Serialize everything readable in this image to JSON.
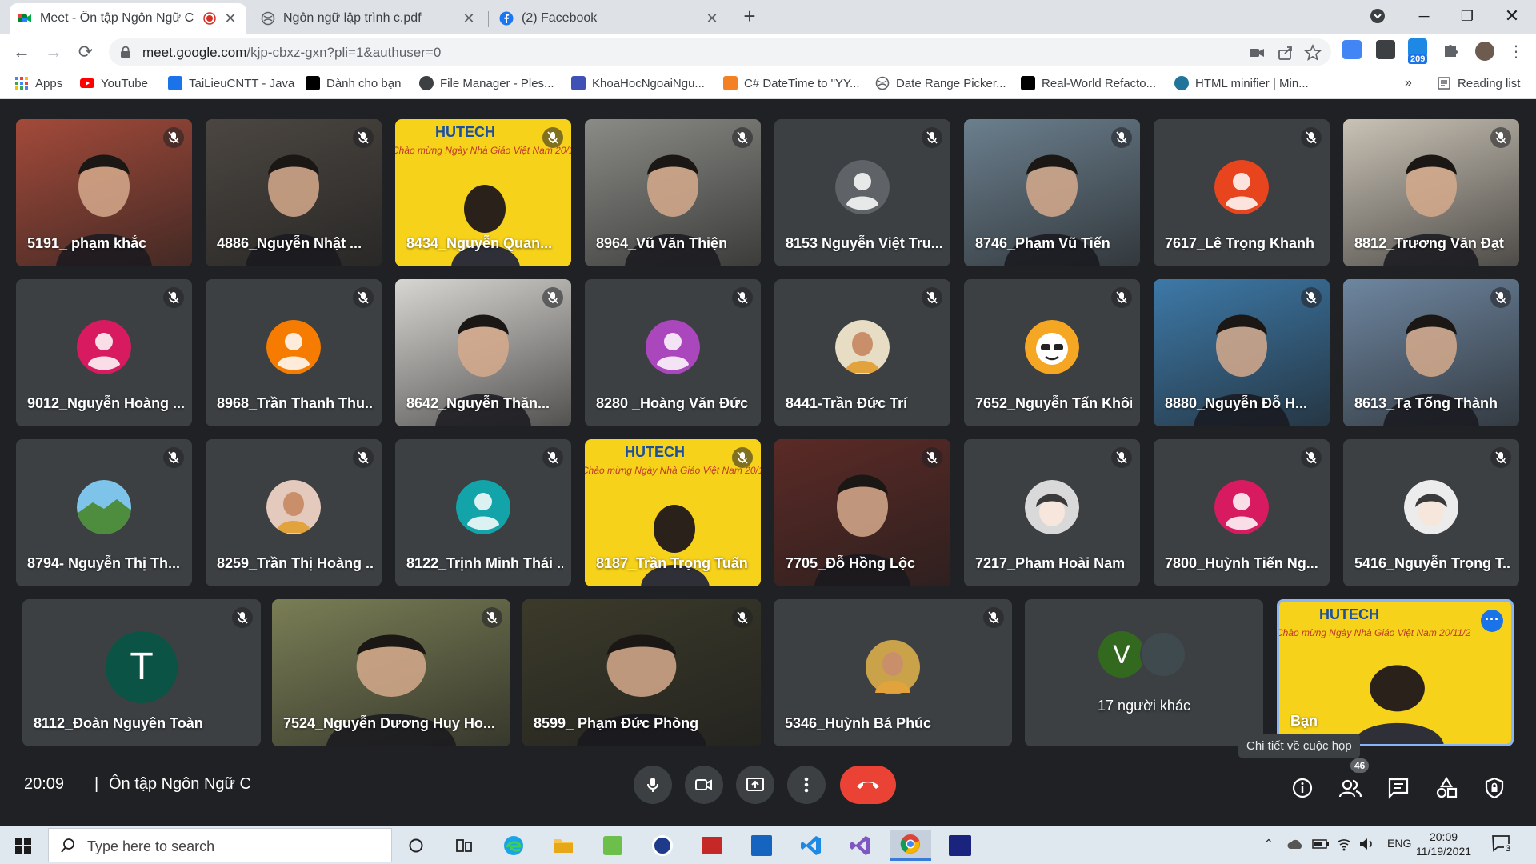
{
  "browser": {
    "tabs": [
      {
        "title": "Meet - Ôn tập Ngôn Ngữ C",
        "icon": "meet-icon",
        "recording": true
      },
      {
        "title": "Ngôn ngữ lập trình c.pdf",
        "icon": "globe-icon"
      },
      {
        "title": "(2) Facebook",
        "icon": "facebook-icon"
      }
    ],
    "url_host": "meet.google.com",
    "url_rest": "/kjp-cbxz-gxn?pli=1&authuser=0",
    "extension_badge": "209"
  },
  "bookmarks": [
    {
      "label": "Apps",
      "icon": "apps-icon",
      "color": "#4285f4"
    },
    {
      "label": "YouTube",
      "icon": "youtube-icon",
      "color": "#ff0000"
    },
    {
      "label": "TaiLieuCNTT - Java",
      "icon": "tailieu-icon",
      "color": "#1a73e8"
    },
    {
      "label": "Dành cho bạn",
      "icon": "tiktok-icon",
      "color": "#000000"
    },
    {
      "label": "File Manager - Ples...",
      "icon": "plesk-icon",
      "color": "#3c4043"
    },
    {
      "label": "KhoaHocNgoaiNgu...",
      "icon": "khoahoc-icon",
      "color": "#3f51b5"
    },
    {
      "label": "C# DateTime to \"YY...",
      "icon": "csharp-icon",
      "color": "#f48024"
    },
    {
      "label": "Date Range Picker...",
      "icon": "globe-icon",
      "color": "#5f6368"
    },
    {
      "label": "Real-World Refacto...",
      "icon": "dw-icon",
      "color": "#000000"
    },
    {
      "label": "HTML minifier | Min...",
      "icon": "wordpress-icon",
      "color": "#21759b"
    }
  ],
  "bookmarks_overflow": "»",
  "reading_list": "Reading list",
  "participants": [
    {
      "name": "5191_ phạm khắc",
      "type": "video",
      "bg": "#a34a3a"
    },
    {
      "name": "4886_Nguyễn Nhật ...",
      "type": "video",
      "bg": "#4b4641"
    },
    {
      "name": "8434_Nguyễn Quan...",
      "type": "hutech",
      "bg": "#f7d21a"
    },
    {
      "name": "8964_Vũ Văn Thiện",
      "type": "video",
      "bg": "#8a8b86"
    },
    {
      "name": "8153 Nguyễn Việt Tru...",
      "type": "avatar",
      "avatar": "default",
      "color": "#5f6368"
    },
    {
      "name": "8746_Phạm Vũ Tiến",
      "type": "video",
      "bg": "#6b7f8e"
    },
    {
      "name": "7617_Lê Trọng Khanh",
      "type": "avatar",
      "avatar": "initial-person",
      "color": "#e8451f"
    },
    {
      "name": "8812_Trương Văn Đạt",
      "type": "video",
      "bg": "#c9c2b5"
    },
    {
      "name": "9012_Nguyễn Hoàng ...",
      "type": "avatar",
      "avatar": "initial-person",
      "color": "#d81b60"
    },
    {
      "name": "8968_Trần Thanh Thu...",
      "type": "avatar",
      "avatar": "initial-person",
      "color": "#f57c00"
    },
    {
      "name": "8642_Nguyễn Thăn...",
      "type": "video",
      "bg": "#d8d6d2"
    },
    {
      "name": "8280 _Hoàng Văn Đức",
      "type": "avatar",
      "avatar": "initial-person",
      "color": "#ab47bc"
    },
    {
      "name": "8441-Trần Đức Trí",
      "type": "avatar",
      "avatar": "photo",
      "color": "#e7dcc4"
    },
    {
      "name": "7652_Nguyễn Tấn Khôi",
      "type": "avatar",
      "avatar": "cartoon",
      "color": "#f5a623"
    },
    {
      "name": "8880_Nguyễn Đỗ H...",
      "type": "video",
      "bg": "#3d79a8"
    },
    {
      "name": "8613_Tạ Tống Thành",
      "type": "video",
      "bg": "#6e86a0"
    },
    {
      "name": "8794- Nguyễn Thị Th...",
      "type": "avatar",
      "avatar": "landscape",
      "color": "#4f8d3e"
    },
    {
      "name": "8259_Trần Thị Hoàng ...",
      "type": "avatar",
      "avatar": "photo",
      "color": "#e4c9bd"
    },
    {
      "name": "8122_Trịnh Minh Thái ...",
      "type": "avatar",
      "avatar": "initial-person",
      "color": "#12a4a8"
    },
    {
      "name": "8187_Trần Trọng Tuấn",
      "type": "hutech",
      "bg": "#f7d21a"
    },
    {
      "name": "7705_Đỗ Hồng Lộc",
      "type": "video",
      "bg": "#5b2a26"
    },
    {
      "name": "7217_Phạm Hoài Nam",
      "type": "avatar",
      "avatar": "anime",
      "color": "#d9d9d9"
    },
    {
      "name": "7800_Huỳnh Tiến Ng...",
      "type": "avatar",
      "avatar": "initial-person",
      "color": "#d81b60"
    },
    {
      "name": "5416_Nguyễn Trọng T...",
      "type": "avatar",
      "avatar": "anime",
      "color": "#ececec"
    }
  ],
  "bottom_row": [
    {
      "name": "8112_Đoàn Nguyên Toàn",
      "type": "letter",
      "letter": "T",
      "color": "#0b5345"
    },
    {
      "name": "7524_Nguyễn Dương Huy Ho...",
      "type": "video",
      "bg": "#7a7e55"
    },
    {
      "name": "8599_ Phạm Đức Phòng",
      "type": "video",
      "bg": "#3b3a2a"
    },
    {
      "name": "5346_Huỳnh Bá Phúc",
      "type": "avatar",
      "avatar": "photo",
      "color": "#c9a24a"
    },
    {
      "name": "17 người khác",
      "type": "others",
      "letter": "V",
      "color": "#33691e"
    },
    {
      "name": "Bạn",
      "type": "self",
      "bg": "#f7d21a"
    }
  ],
  "hutech": {
    "brand": "HUTECH",
    "banner": "Chào mừng Ngày Nhà Giáo Việt Nam 20/11/2"
  },
  "meeting": {
    "time": "20:09",
    "separator": "|",
    "title": "Ôn tập Ngôn Ngữ C",
    "tooltip": "Chi tiết về cuộc họp",
    "participant_count": "46"
  },
  "taskbar": {
    "search_placeholder": "Type here to search",
    "language": "ENG",
    "time": "20:09",
    "date": "11/19/2021",
    "notification_count": "3"
  },
  "colors": {
    "end_call": "#ea4335",
    "self_border": "#8ab4f8",
    "meet_bg": "#202124"
  }
}
